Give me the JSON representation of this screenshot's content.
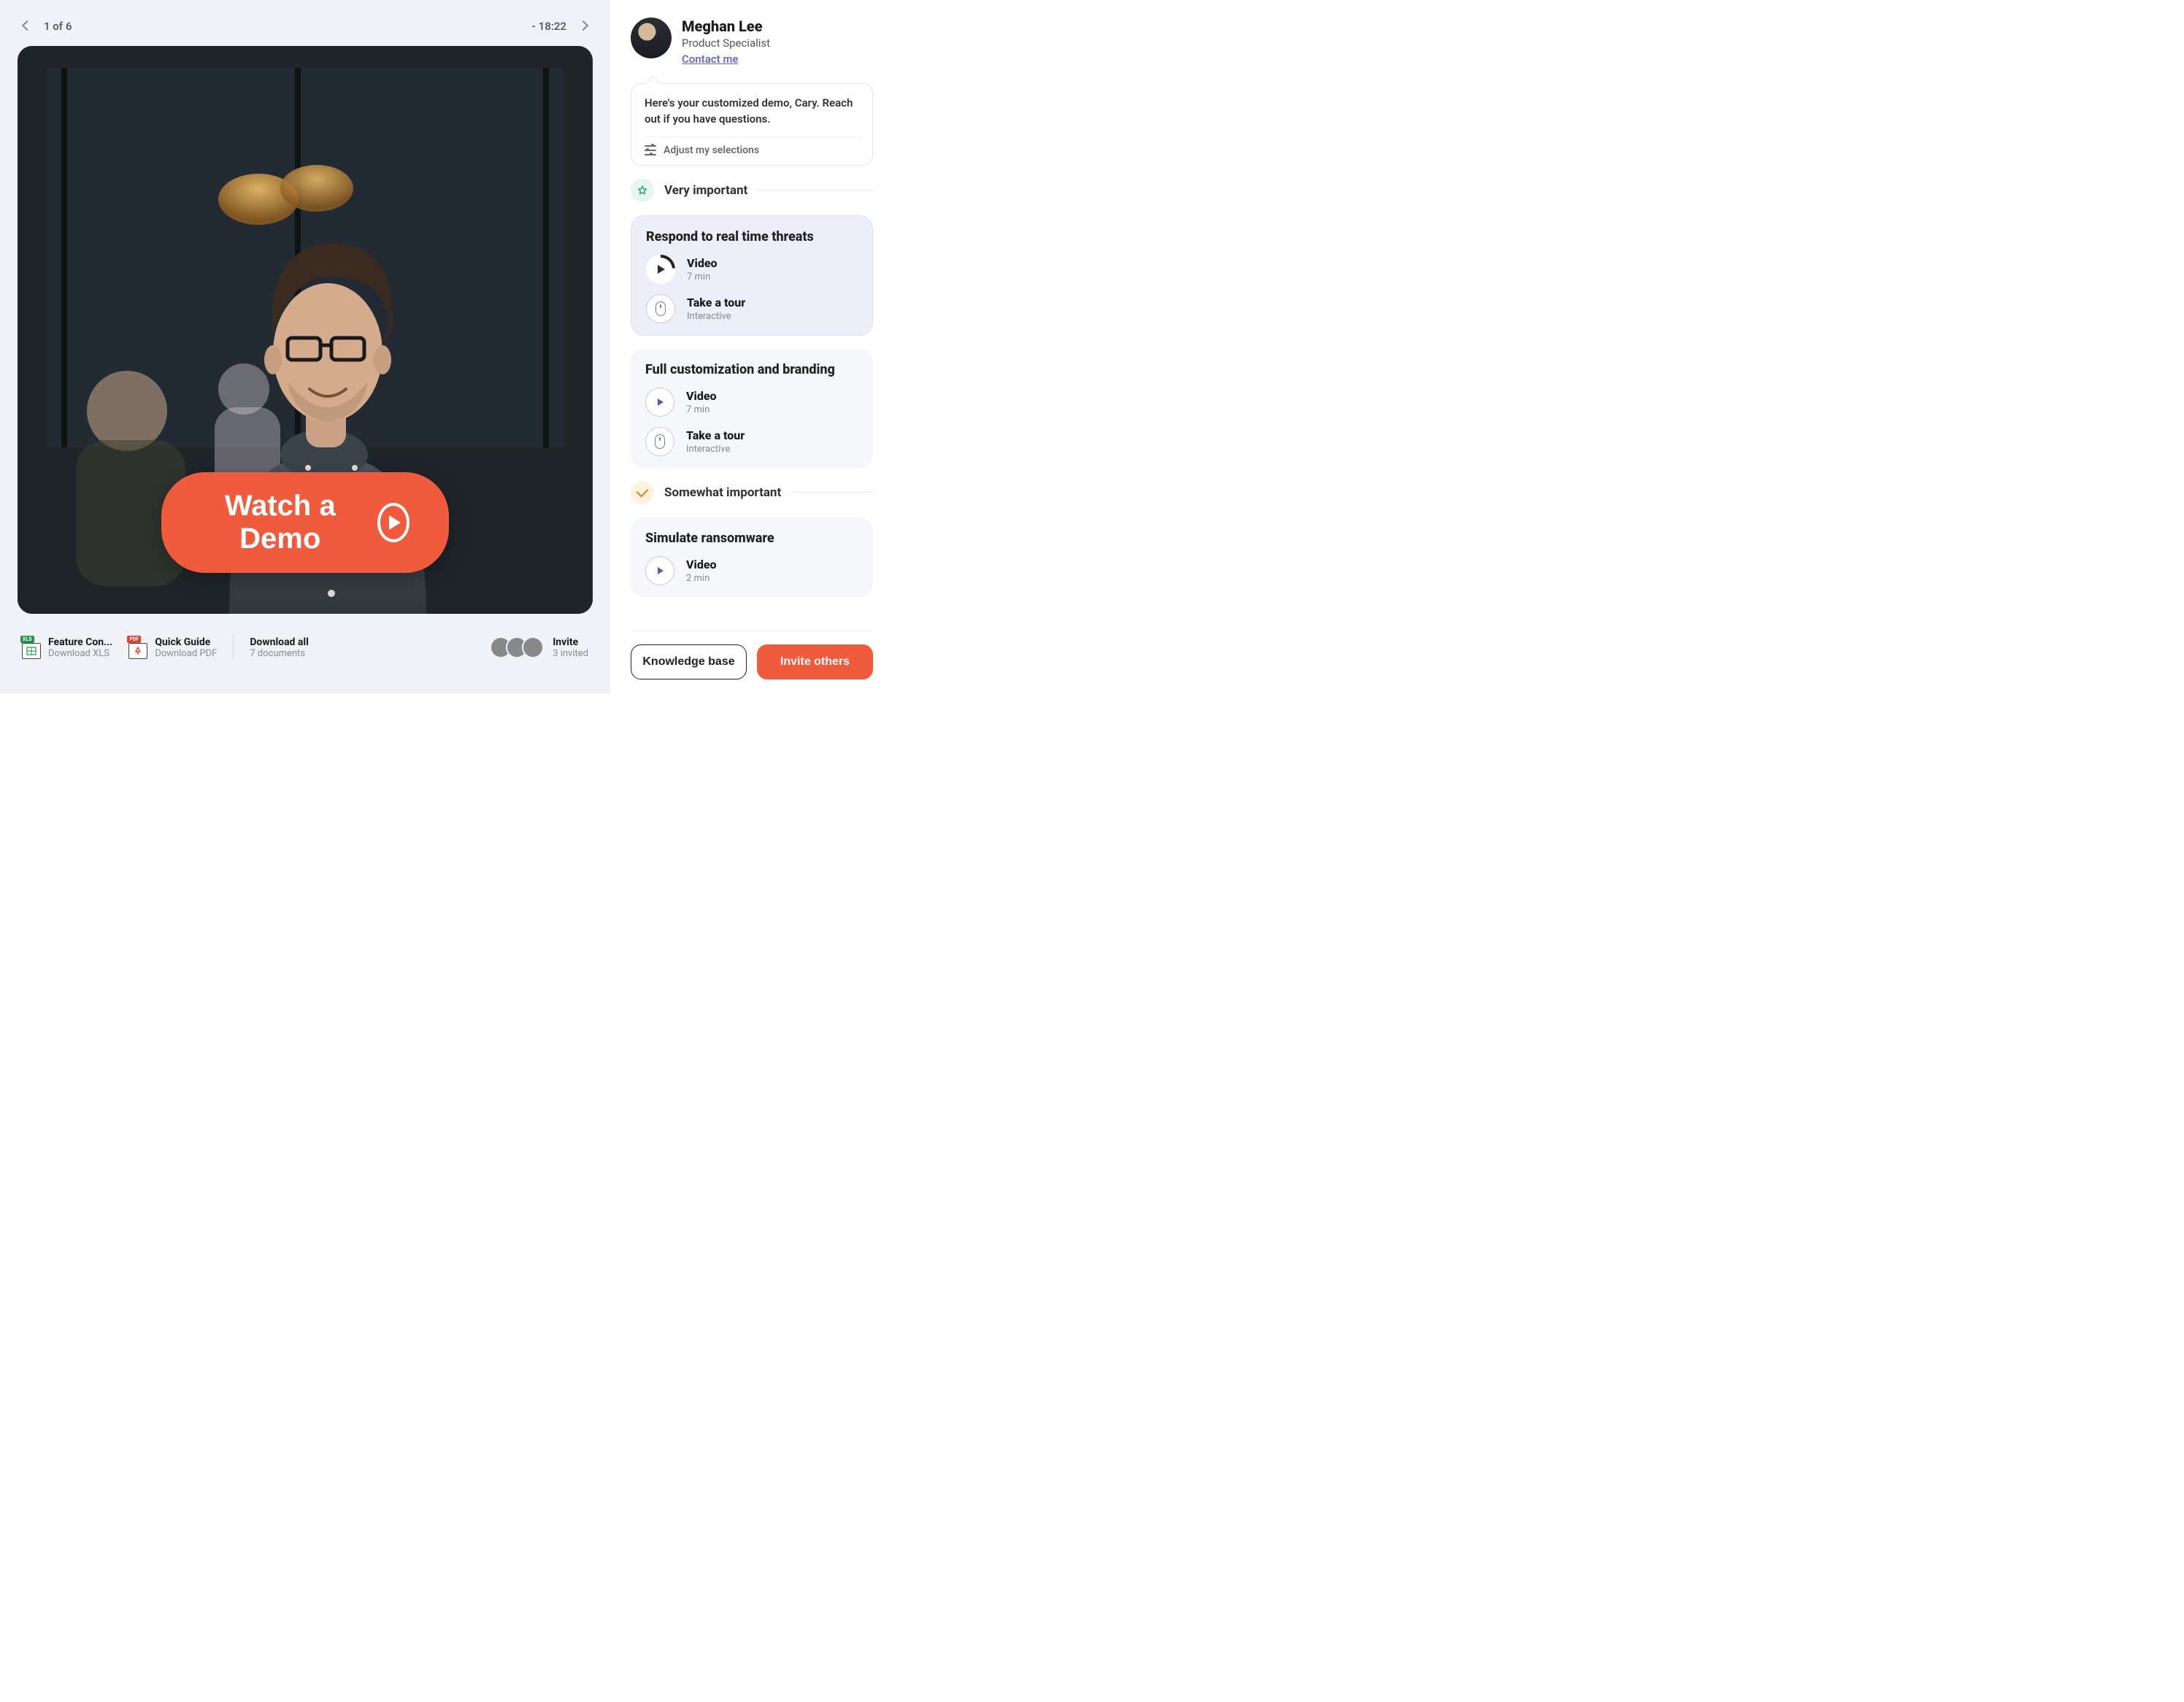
{
  "nav": {
    "position": "1 of 6",
    "time_remaining": "- 18:22"
  },
  "hero": {
    "cta": "Watch a Demo"
  },
  "downloads": {
    "doc1": {
      "badge": "XLS",
      "title": "Feature Con...",
      "sub": "Download XLS"
    },
    "doc2": {
      "badge": "PDF",
      "title": "Quick Guide",
      "sub": "Download PDF"
    },
    "all": {
      "title": "Download all",
      "sub": "7 documents"
    },
    "invite": {
      "title": "Invite",
      "sub": "3 invited"
    }
  },
  "specialist": {
    "name": "Meghan Lee",
    "role": "Product Specialist",
    "contact": "Contact me"
  },
  "bubble": {
    "message": "Here's your customized demo, Cary. Reach out if you have questions.",
    "adjust": "Adjust my selections"
  },
  "importance": {
    "very": "Very important",
    "some": "Somewhat important"
  },
  "cards": {
    "c1": {
      "title": "Respond to real time threats",
      "video_label": "Video",
      "video_sub": "7 min",
      "tour_label": "Take a tour",
      "tour_sub": "Interactive"
    },
    "c2": {
      "title": "Full customization and branding",
      "video_label": "Video",
      "video_sub": "7 min",
      "tour_label": "Take a tour",
      "tour_sub": "Interactive"
    },
    "c3": {
      "title": "Simulate ransomware",
      "video_label": "Video",
      "video_sub": "2 min"
    }
  },
  "footer": {
    "kb": "Knowledge base",
    "invite": "Invite others"
  }
}
